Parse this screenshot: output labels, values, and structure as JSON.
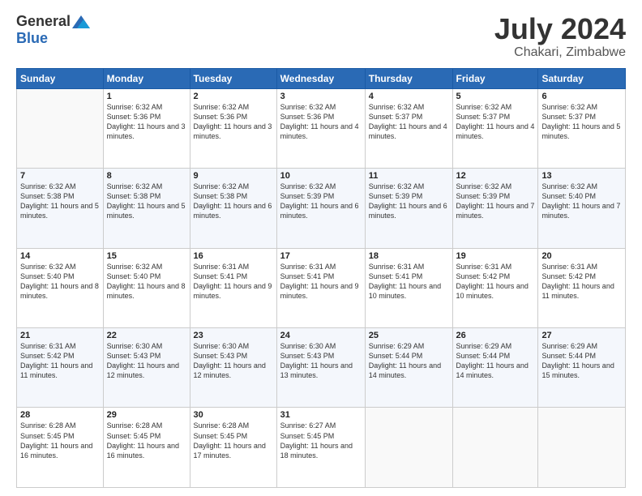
{
  "logo": {
    "general": "General",
    "blue": "Blue"
  },
  "title": "July 2024",
  "location": "Chakari, Zimbabwe",
  "days_header": [
    "Sunday",
    "Monday",
    "Tuesday",
    "Wednesday",
    "Thursday",
    "Friday",
    "Saturday"
  ],
  "weeks": [
    [
      {
        "day": "",
        "sunrise": "",
        "sunset": "",
        "daylight": ""
      },
      {
        "day": "1",
        "sunrise": "Sunrise: 6:32 AM",
        "sunset": "Sunset: 5:36 PM",
        "daylight": "Daylight: 11 hours and 3 minutes."
      },
      {
        "day": "2",
        "sunrise": "Sunrise: 6:32 AM",
        "sunset": "Sunset: 5:36 PM",
        "daylight": "Daylight: 11 hours and 3 minutes."
      },
      {
        "day": "3",
        "sunrise": "Sunrise: 6:32 AM",
        "sunset": "Sunset: 5:36 PM",
        "daylight": "Daylight: 11 hours and 4 minutes."
      },
      {
        "day": "4",
        "sunrise": "Sunrise: 6:32 AM",
        "sunset": "Sunset: 5:37 PM",
        "daylight": "Daylight: 11 hours and 4 minutes."
      },
      {
        "day": "5",
        "sunrise": "Sunrise: 6:32 AM",
        "sunset": "Sunset: 5:37 PM",
        "daylight": "Daylight: 11 hours and 4 minutes."
      },
      {
        "day": "6",
        "sunrise": "Sunrise: 6:32 AM",
        "sunset": "Sunset: 5:37 PM",
        "daylight": "Daylight: 11 hours and 5 minutes."
      }
    ],
    [
      {
        "day": "7",
        "sunrise": "Sunrise: 6:32 AM",
        "sunset": "Sunset: 5:38 PM",
        "daylight": "Daylight: 11 hours and 5 minutes."
      },
      {
        "day": "8",
        "sunrise": "Sunrise: 6:32 AM",
        "sunset": "Sunset: 5:38 PM",
        "daylight": "Daylight: 11 hours and 5 minutes."
      },
      {
        "day": "9",
        "sunrise": "Sunrise: 6:32 AM",
        "sunset": "Sunset: 5:38 PM",
        "daylight": "Daylight: 11 hours and 6 minutes."
      },
      {
        "day": "10",
        "sunrise": "Sunrise: 6:32 AM",
        "sunset": "Sunset: 5:39 PM",
        "daylight": "Daylight: 11 hours and 6 minutes."
      },
      {
        "day": "11",
        "sunrise": "Sunrise: 6:32 AM",
        "sunset": "Sunset: 5:39 PM",
        "daylight": "Daylight: 11 hours and 6 minutes."
      },
      {
        "day": "12",
        "sunrise": "Sunrise: 6:32 AM",
        "sunset": "Sunset: 5:39 PM",
        "daylight": "Daylight: 11 hours and 7 minutes."
      },
      {
        "day": "13",
        "sunrise": "Sunrise: 6:32 AM",
        "sunset": "Sunset: 5:40 PM",
        "daylight": "Daylight: 11 hours and 7 minutes."
      }
    ],
    [
      {
        "day": "14",
        "sunrise": "Sunrise: 6:32 AM",
        "sunset": "Sunset: 5:40 PM",
        "daylight": "Daylight: 11 hours and 8 minutes."
      },
      {
        "day": "15",
        "sunrise": "Sunrise: 6:32 AM",
        "sunset": "Sunset: 5:40 PM",
        "daylight": "Daylight: 11 hours and 8 minutes."
      },
      {
        "day": "16",
        "sunrise": "Sunrise: 6:31 AM",
        "sunset": "Sunset: 5:41 PM",
        "daylight": "Daylight: 11 hours and 9 minutes."
      },
      {
        "day": "17",
        "sunrise": "Sunrise: 6:31 AM",
        "sunset": "Sunset: 5:41 PM",
        "daylight": "Daylight: 11 hours and 9 minutes."
      },
      {
        "day": "18",
        "sunrise": "Sunrise: 6:31 AM",
        "sunset": "Sunset: 5:41 PM",
        "daylight": "Daylight: 11 hours and 10 minutes."
      },
      {
        "day": "19",
        "sunrise": "Sunrise: 6:31 AM",
        "sunset": "Sunset: 5:42 PM",
        "daylight": "Daylight: 11 hours and 10 minutes."
      },
      {
        "day": "20",
        "sunrise": "Sunrise: 6:31 AM",
        "sunset": "Sunset: 5:42 PM",
        "daylight": "Daylight: 11 hours and 11 minutes."
      }
    ],
    [
      {
        "day": "21",
        "sunrise": "Sunrise: 6:31 AM",
        "sunset": "Sunset: 5:42 PM",
        "daylight": "Daylight: 11 hours and 11 minutes."
      },
      {
        "day": "22",
        "sunrise": "Sunrise: 6:30 AM",
        "sunset": "Sunset: 5:43 PM",
        "daylight": "Daylight: 11 hours and 12 minutes."
      },
      {
        "day": "23",
        "sunrise": "Sunrise: 6:30 AM",
        "sunset": "Sunset: 5:43 PM",
        "daylight": "Daylight: 11 hours and 12 minutes."
      },
      {
        "day": "24",
        "sunrise": "Sunrise: 6:30 AM",
        "sunset": "Sunset: 5:43 PM",
        "daylight": "Daylight: 11 hours and 13 minutes."
      },
      {
        "day": "25",
        "sunrise": "Sunrise: 6:29 AM",
        "sunset": "Sunset: 5:44 PM",
        "daylight": "Daylight: 11 hours and 14 minutes."
      },
      {
        "day": "26",
        "sunrise": "Sunrise: 6:29 AM",
        "sunset": "Sunset: 5:44 PM",
        "daylight": "Daylight: 11 hours and 14 minutes."
      },
      {
        "day": "27",
        "sunrise": "Sunrise: 6:29 AM",
        "sunset": "Sunset: 5:44 PM",
        "daylight": "Daylight: 11 hours and 15 minutes."
      }
    ],
    [
      {
        "day": "28",
        "sunrise": "Sunrise: 6:28 AM",
        "sunset": "Sunset: 5:45 PM",
        "daylight": "Daylight: 11 hours and 16 minutes."
      },
      {
        "day": "29",
        "sunrise": "Sunrise: 6:28 AM",
        "sunset": "Sunset: 5:45 PM",
        "daylight": "Daylight: 11 hours and 16 minutes."
      },
      {
        "day": "30",
        "sunrise": "Sunrise: 6:28 AM",
        "sunset": "Sunset: 5:45 PM",
        "daylight": "Daylight: 11 hours and 17 minutes."
      },
      {
        "day": "31",
        "sunrise": "Sunrise: 6:27 AM",
        "sunset": "Sunset: 5:45 PM",
        "daylight": "Daylight: 11 hours and 18 minutes."
      },
      {
        "day": "",
        "sunrise": "",
        "sunset": "",
        "daylight": ""
      },
      {
        "day": "",
        "sunrise": "",
        "sunset": "",
        "daylight": ""
      },
      {
        "day": "",
        "sunrise": "",
        "sunset": "",
        "daylight": ""
      }
    ]
  ]
}
